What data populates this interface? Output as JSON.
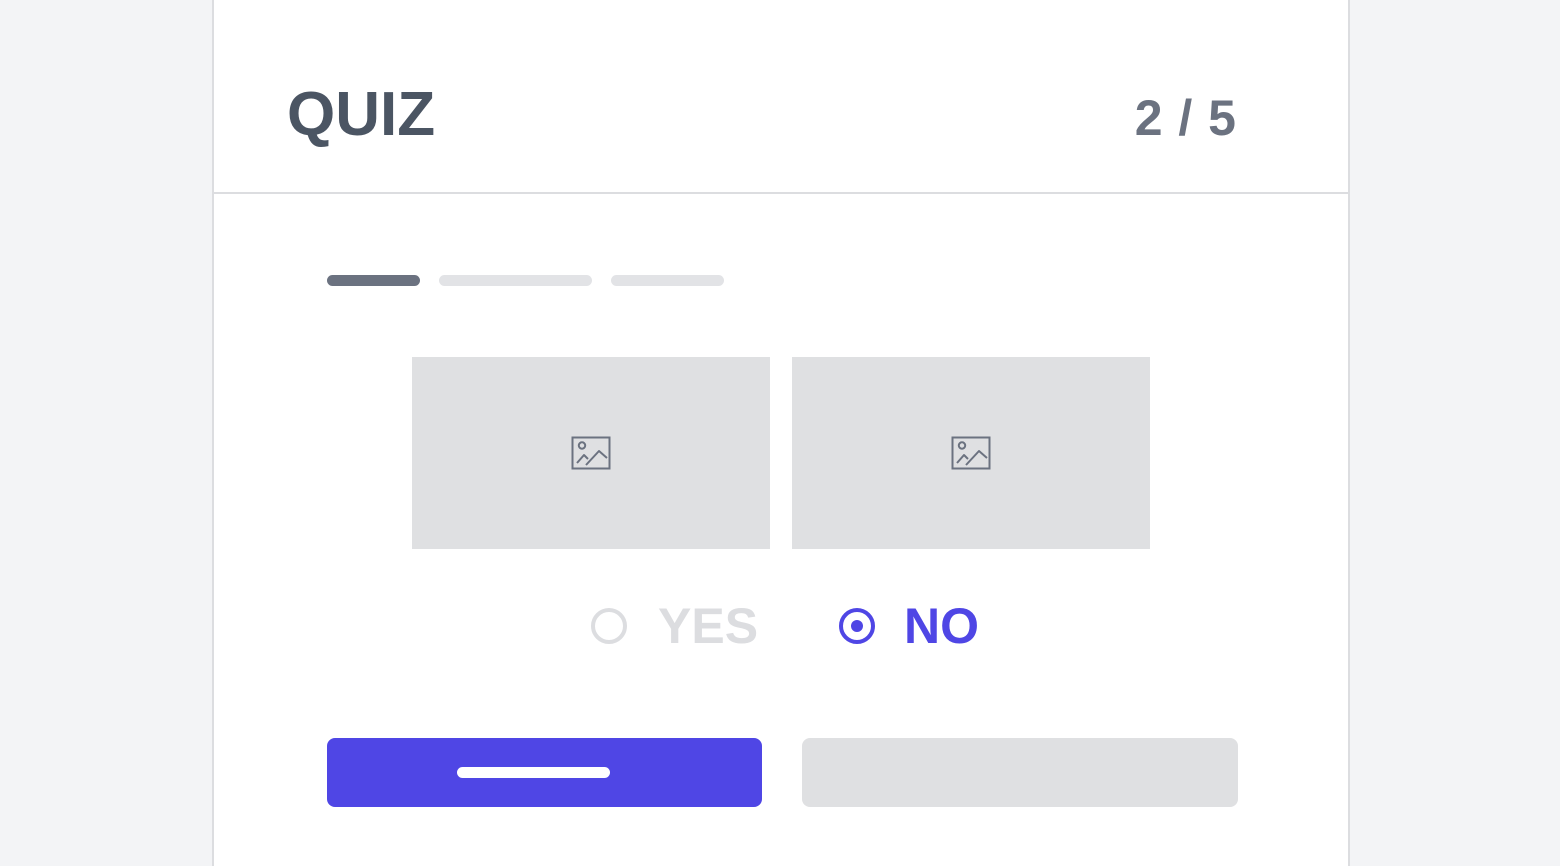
{
  "header": {
    "title": "QUIZ",
    "counter": "2 / 5"
  },
  "progress": {
    "current_segment": 1,
    "total_segments": 3
  },
  "images": [
    {
      "icon": "image-placeholder-icon"
    },
    {
      "icon": "image-placeholder-icon"
    }
  ],
  "options": [
    {
      "label": "YES",
      "selected": false
    },
    {
      "label": "NO",
      "selected": true
    }
  ],
  "colors": {
    "accent": "#4f46e5",
    "title": "#4b5563",
    "counter": "#6b7280",
    "muted": "#dcdde0",
    "placeholder_bg": "#dfe0e2",
    "page_bg": "#f3f4f6"
  }
}
